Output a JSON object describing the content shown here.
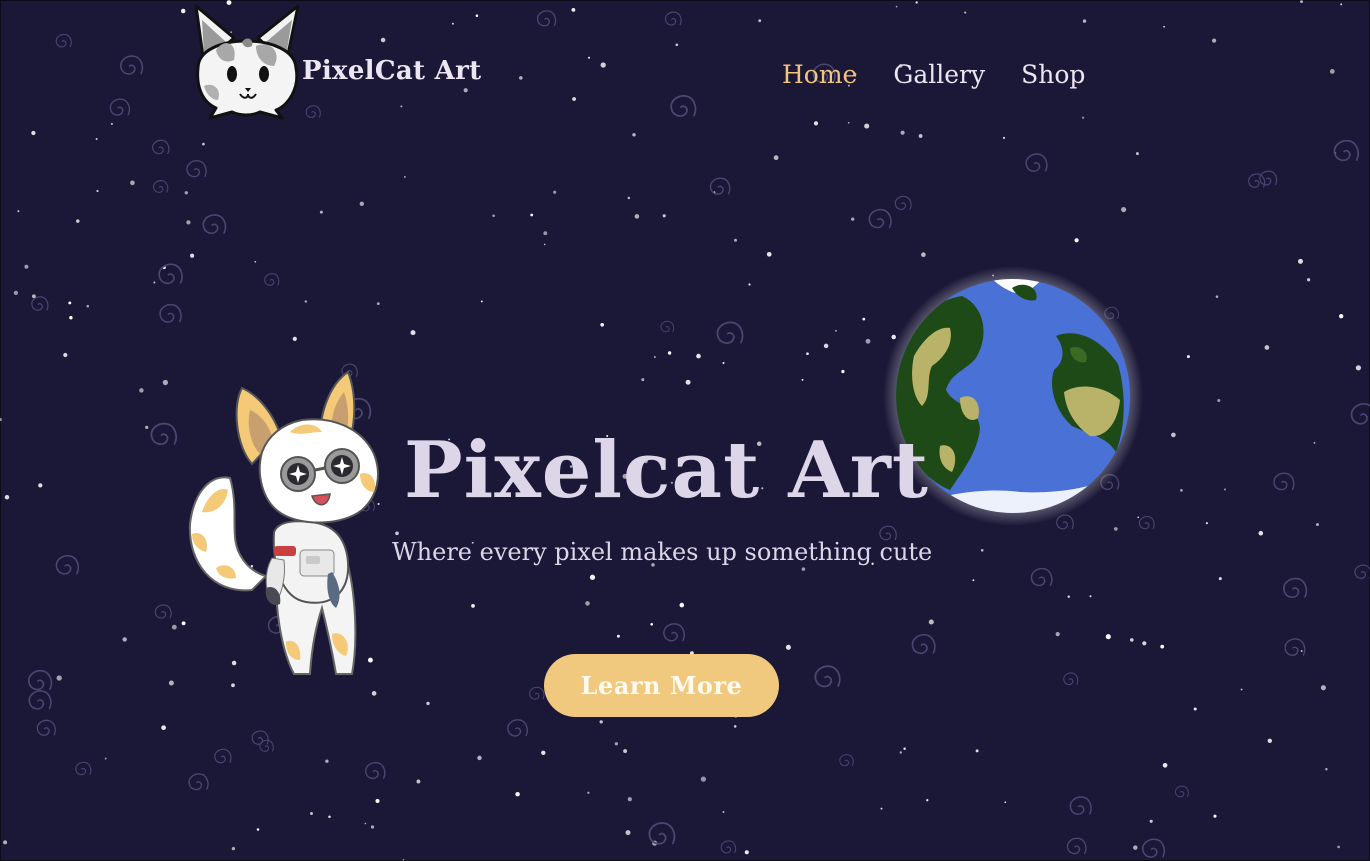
{
  "header": {
    "brand": "PixelCat Art",
    "nav": [
      {
        "label": "Home",
        "active": true
      },
      {
        "label": "Gallery",
        "active": false
      },
      {
        "label": "Shop",
        "active": false
      }
    ]
  },
  "hero": {
    "title": "Pixelcat Art",
    "subtitle": "Where every pixel makes up something cute",
    "cta_label": "Learn More"
  },
  "images": {
    "logo": "grey-cat-head-logo",
    "mascot": "astronaut-cat-mascot",
    "planet": "earth-planet"
  },
  "colors": {
    "background": "#1b1837",
    "text": "#ece6f2",
    "accent": "#f2c57c",
    "button": "#f0c97e"
  }
}
